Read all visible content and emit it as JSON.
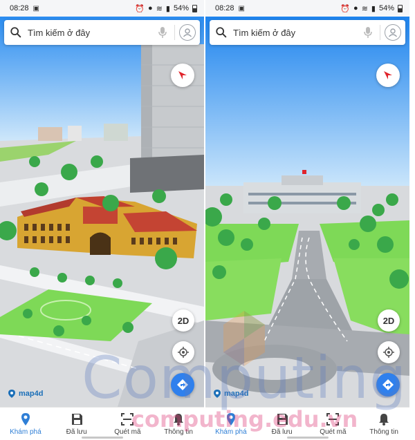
{
  "screens": [
    {
      "status": {
        "time": "08:28",
        "battery": "54%"
      },
      "search": {
        "placeholder": "Tìm kiếm ở đây"
      },
      "map_controls": {
        "view_toggle": "2D"
      },
      "brand": "map4d",
      "nav": [
        {
          "label": "Khám phá",
          "icon": "pin-icon",
          "active": true
        },
        {
          "label": "Đã lưu",
          "icon": "save-icon",
          "active": false
        },
        {
          "label": "Quét mã",
          "icon": "scan-icon",
          "active": false
        },
        {
          "label": "Thông tin",
          "icon": "bell-icon",
          "active": false
        }
      ]
    },
    {
      "status": {
        "time": "08:28",
        "battery": "54%"
      },
      "search": {
        "placeholder": "Tìm kiếm ở đây"
      },
      "map_controls": {
        "view_toggle": "2D"
      },
      "brand": "map4d",
      "nav": [
        {
          "label": "Khám phá",
          "icon": "pin-icon",
          "active": true
        },
        {
          "label": "Đã lưu",
          "icon": "save-icon",
          "active": false
        },
        {
          "label": "Quét mã",
          "icon": "scan-icon",
          "active": false
        },
        {
          "label": "Thông tin",
          "icon": "bell-icon",
          "active": false
        }
      ]
    }
  ],
  "watermark": {
    "big": "Computing",
    "small": "computing.edu.vn"
  },
  "colors": {
    "accent": "#2f80ed",
    "nav_active": "#2f7fd6",
    "grass": "#7ed957",
    "sky": "#1e90f0",
    "compass_red": "#e0242b"
  }
}
